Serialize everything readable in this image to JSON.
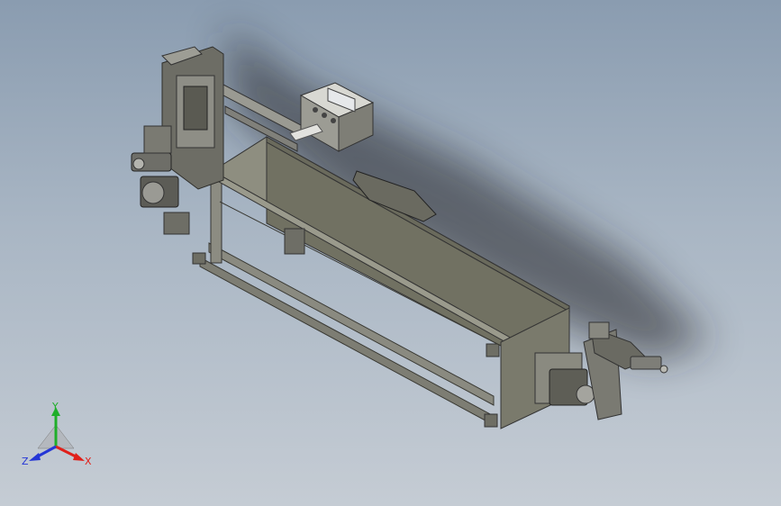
{
  "triad": {
    "x_label": "X",
    "y_label": "Y",
    "z_label": "Z",
    "x_color": "#e0201a",
    "y_color": "#1fae2a",
    "z_color": "#2436d6"
  },
  "colors": {
    "frame": "#7a7a70",
    "frame_dark": "#55554d",
    "panel": "#70705f",
    "background_top": "#8a9cb0",
    "background_bottom": "#c5ccd4"
  }
}
